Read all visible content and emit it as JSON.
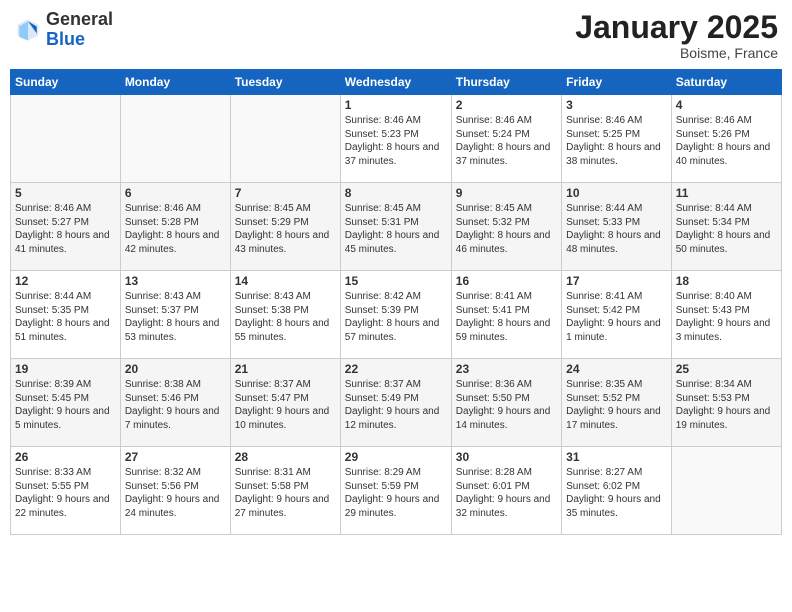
{
  "header": {
    "logo_line1": "General",
    "logo_line2": "Blue",
    "month_year": "January 2025",
    "location": "Boisme, France"
  },
  "weekdays": [
    "Sunday",
    "Monday",
    "Tuesday",
    "Wednesday",
    "Thursday",
    "Friday",
    "Saturday"
  ],
  "weeks": [
    [
      {
        "day": "",
        "content": ""
      },
      {
        "day": "",
        "content": ""
      },
      {
        "day": "",
        "content": ""
      },
      {
        "day": "1",
        "content": "Sunrise: 8:46 AM\nSunset: 5:23 PM\nDaylight: 8 hours and 37 minutes."
      },
      {
        "day": "2",
        "content": "Sunrise: 8:46 AM\nSunset: 5:24 PM\nDaylight: 8 hours and 37 minutes."
      },
      {
        "day": "3",
        "content": "Sunrise: 8:46 AM\nSunset: 5:25 PM\nDaylight: 8 hours and 38 minutes."
      },
      {
        "day": "4",
        "content": "Sunrise: 8:46 AM\nSunset: 5:26 PM\nDaylight: 8 hours and 40 minutes."
      }
    ],
    [
      {
        "day": "5",
        "content": "Sunrise: 8:46 AM\nSunset: 5:27 PM\nDaylight: 8 hours and 41 minutes."
      },
      {
        "day": "6",
        "content": "Sunrise: 8:46 AM\nSunset: 5:28 PM\nDaylight: 8 hours and 42 minutes."
      },
      {
        "day": "7",
        "content": "Sunrise: 8:45 AM\nSunset: 5:29 PM\nDaylight: 8 hours and 43 minutes."
      },
      {
        "day": "8",
        "content": "Sunrise: 8:45 AM\nSunset: 5:31 PM\nDaylight: 8 hours and 45 minutes."
      },
      {
        "day": "9",
        "content": "Sunrise: 8:45 AM\nSunset: 5:32 PM\nDaylight: 8 hours and 46 minutes."
      },
      {
        "day": "10",
        "content": "Sunrise: 8:44 AM\nSunset: 5:33 PM\nDaylight: 8 hours and 48 minutes."
      },
      {
        "day": "11",
        "content": "Sunrise: 8:44 AM\nSunset: 5:34 PM\nDaylight: 8 hours and 50 minutes."
      }
    ],
    [
      {
        "day": "12",
        "content": "Sunrise: 8:44 AM\nSunset: 5:35 PM\nDaylight: 8 hours and 51 minutes."
      },
      {
        "day": "13",
        "content": "Sunrise: 8:43 AM\nSunset: 5:37 PM\nDaylight: 8 hours and 53 minutes."
      },
      {
        "day": "14",
        "content": "Sunrise: 8:43 AM\nSunset: 5:38 PM\nDaylight: 8 hours and 55 minutes."
      },
      {
        "day": "15",
        "content": "Sunrise: 8:42 AM\nSunset: 5:39 PM\nDaylight: 8 hours and 57 minutes."
      },
      {
        "day": "16",
        "content": "Sunrise: 8:41 AM\nSunset: 5:41 PM\nDaylight: 8 hours and 59 minutes."
      },
      {
        "day": "17",
        "content": "Sunrise: 8:41 AM\nSunset: 5:42 PM\nDaylight: 9 hours and 1 minute."
      },
      {
        "day": "18",
        "content": "Sunrise: 8:40 AM\nSunset: 5:43 PM\nDaylight: 9 hours and 3 minutes."
      }
    ],
    [
      {
        "day": "19",
        "content": "Sunrise: 8:39 AM\nSunset: 5:45 PM\nDaylight: 9 hours and 5 minutes."
      },
      {
        "day": "20",
        "content": "Sunrise: 8:38 AM\nSunset: 5:46 PM\nDaylight: 9 hours and 7 minutes."
      },
      {
        "day": "21",
        "content": "Sunrise: 8:37 AM\nSunset: 5:47 PM\nDaylight: 9 hours and 10 minutes."
      },
      {
        "day": "22",
        "content": "Sunrise: 8:37 AM\nSunset: 5:49 PM\nDaylight: 9 hours and 12 minutes."
      },
      {
        "day": "23",
        "content": "Sunrise: 8:36 AM\nSunset: 5:50 PM\nDaylight: 9 hours and 14 minutes."
      },
      {
        "day": "24",
        "content": "Sunrise: 8:35 AM\nSunset: 5:52 PM\nDaylight: 9 hours and 17 minutes."
      },
      {
        "day": "25",
        "content": "Sunrise: 8:34 AM\nSunset: 5:53 PM\nDaylight: 9 hours and 19 minutes."
      }
    ],
    [
      {
        "day": "26",
        "content": "Sunrise: 8:33 AM\nSunset: 5:55 PM\nDaylight: 9 hours and 22 minutes."
      },
      {
        "day": "27",
        "content": "Sunrise: 8:32 AM\nSunset: 5:56 PM\nDaylight: 9 hours and 24 minutes."
      },
      {
        "day": "28",
        "content": "Sunrise: 8:31 AM\nSunset: 5:58 PM\nDaylight: 9 hours and 27 minutes."
      },
      {
        "day": "29",
        "content": "Sunrise: 8:29 AM\nSunset: 5:59 PM\nDaylight: 9 hours and 29 minutes."
      },
      {
        "day": "30",
        "content": "Sunrise: 8:28 AM\nSunset: 6:01 PM\nDaylight: 9 hours and 32 minutes."
      },
      {
        "day": "31",
        "content": "Sunrise: 8:27 AM\nSunset: 6:02 PM\nDaylight: 9 hours and 35 minutes."
      },
      {
        "day": "",
        "content": ""
      }
    ]
  ]
}
